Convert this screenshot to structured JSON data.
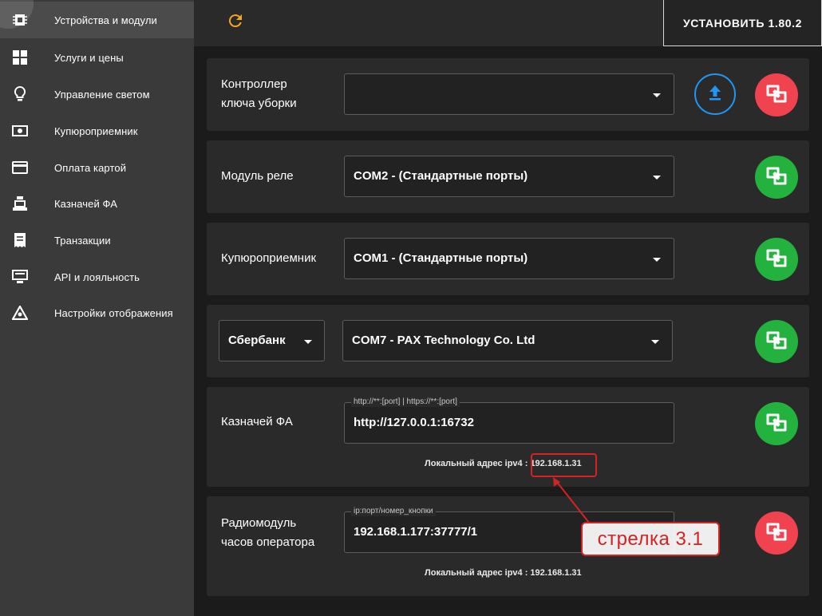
{
  "sidebar": {
    "items": [
      {
        "label": "Устройства и модули",
        "icon": "chip-icon"
      },
      {
        "label": "Услуги и цены",
        "icon": "grid-icon"
      },
      {
        "label": "Управление светом",
        "icon": "lightbulb-icon"
      },
      {
        "label": "Купюроприемник",
        "icon": "banknote-icon"
      },
      {
        "label": "Оплата картой",
        "icon": "credit-card-icon"
      },
      {
        "label": "Казначей ФА",
        "icon": "cash-register-icon"
      },
      {
        "label": "Транзакции",
        "icon": "receipt-icon"
      },
      {
        "label": "API и лояльность",
        "icon": "api-icon"
      },
      {
        "label": "Настройки отображения",
        "icon": "display-settings-icon"
      }
    ]
  },
  "topbar": {
    "install_label": "УСТАНОВИТЬ 1.80.2"
  },
  "cards": {
    "cleaning_key": {
      "label_line1": "Контроллер",
      "label_line2": "ключа уборки",
      "value": ""
    },
    "relay": {
      "label": "Модуль реле",
      "value": "COM2 - (Стандартные порты)"
    },
    "bill_acceptor": {
      "label": "Купюроприемник",
      "value": "COM1 - (Стандартные порты)"
    },
    "card_payment": {
      "bank": "Сбербанк",
      "value": "COM7 - PAX Technology Co. Ltd"
    },
    "treasurer": {
      "label": "Казначей ФА",
      "legend": "http://**:[port] | https://**:[port]",
      "value": "http://127.0.0.1:16732",
      "local_prefix": "Локальный адрес ipv4 :",
      "local_ip": "192.168.1.31"
    },
    "radio": {
      "label_line1": "Радиомодуль",
      "label_line2": "часов оператора",
      "legend": "ip:порт/номер_кнопки",
      "value": "192.168.1.177:37777/1",
      "local_address": "Локальный адрес ipv4 : 192.168.1.31"
    }
  },
  "annotation": {
    "label": "стрелка  3.1"
  },
  "colors": {
    "green": "#23b23e",
    "red": "#f0424f",
    "blue": "#2196f3",
    "refresh": "#f5a623",
    "annotation": "#d62222"
  }
}
